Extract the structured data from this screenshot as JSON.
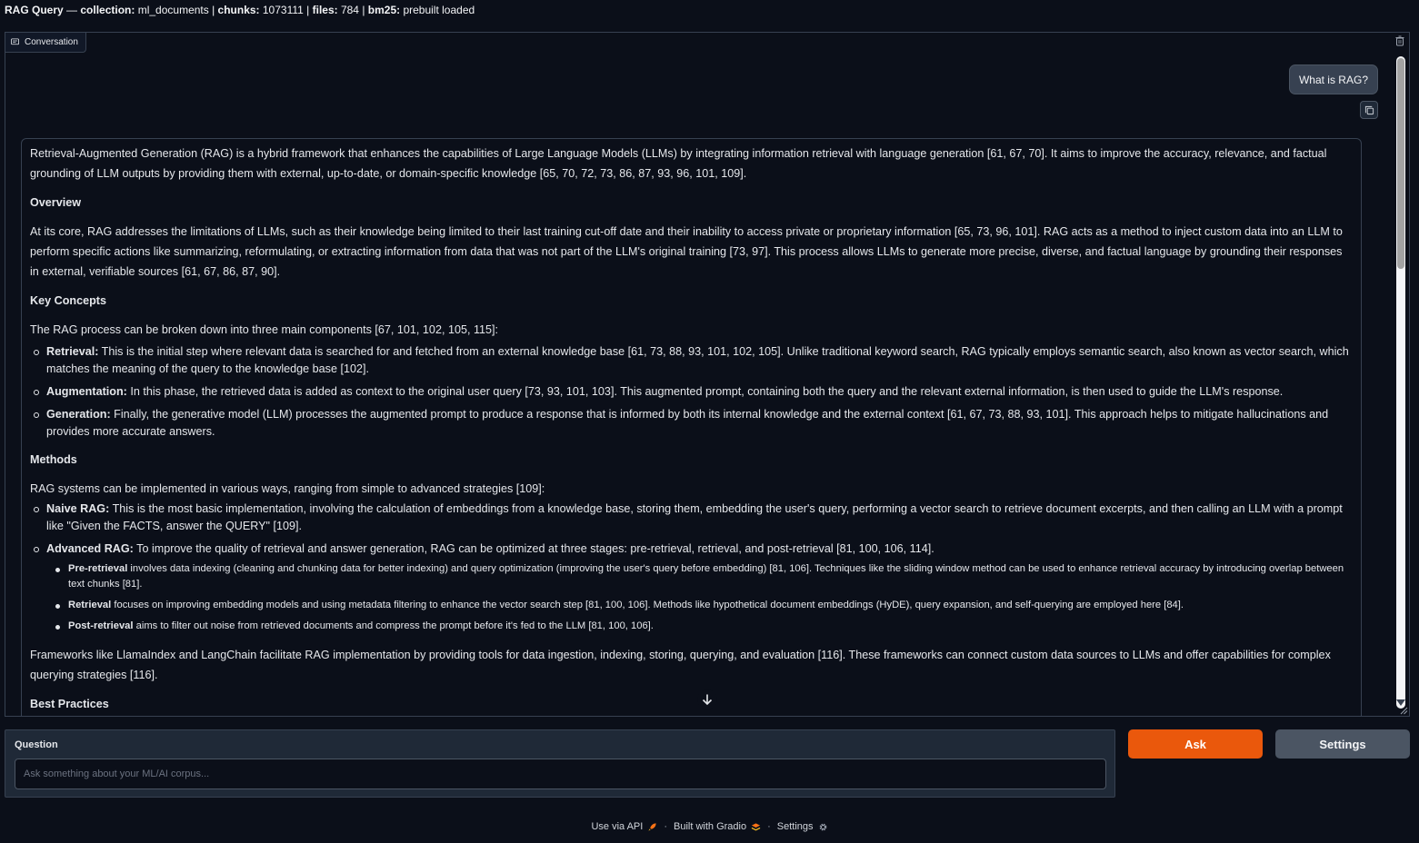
{
  "header": {
    "title": "RAG Query",
    "sep": " — ",
    "collection_label": "collection:",
    "collection_value": " ml_documents | ",
    "chunks_label": "chunks:",
    "chunks_value": " 1073111 | ",
    "files_label": "files:",
    "files_value": " 784 | ",
    "bm25_label": "bm25:",
    "bm25_value": " prebuilt loaded"
  },
  "chat": {
    "label": "Conversation",
    "user_message": "What is RAG?",
    "answer": {
      "intro": "Retrieval-Augmented Generation (RAG) is a hybrid framework that enhances the capabilities of Large Language Models (LLMs) by integrating information retrieval with language generation [61, 67, 70]. It aims to improve the accuracy, relevance, and factual grounding of LLM outputs by providing them with external, up-to-date, or domain-specific knowledge [65, 70, 72, 73, 86, 87, 93, 96, 101, 109].",
      "overview_heading": "Overview",
      "overview_text": "At its core, RAG addresses the limitations of LLMs, such as their knowledge being limited to their last training cut-off date and their inability to access private or proprietary information [65, 73, 96, 101]. RAG acts as a method to inject custom data into an LLM to perform specific actions like summarizing, reformulating, or extracting information from data that was not part of the LLM's original training [73, 97]. This process allows LLMs to generate more precise, diverse, and factual language by grounding their responses in external, verifiable sources [61, 67, 86, 87, 90].",
      "concepts_heading": "Key Concepts",
      "concepts_intro": "The RAG process can be broken down into three main components [67, 101, 102, 105, 115]:",
      "concepts": [
        {
          "term": "Retrieval:",
          "text": " This is the initial step where relevant data is searched for and fetched from an external knowledge base [61, 73, 88, 93, 101, 102, 105]. Unlike traditional keyword search, RAG typically employs semantic search, also known as vector search, which matches the meaning of the query to the knowledge base [102]."
        },
        {
          "term": "Augmentation:",
          "text": " In this phase, the retrieved data is added as context to the original user query [73, 93, 101, 103]. This augmented prompt, containing both the query and the relevant external information, is then used to guide the LLM's response."
        },
        {
          "term": "Generation:",
          "text": " Finally, the generative model (LLM) processes the augmented prompt to produce a response that is informed by both its internal knowledge and the external context [61, 67, 73, 88, 93, 101]. This approach helps to mitigate hallucinations and provides more accurate answers."
        }
      ],
      "methods_heading": "Methods",
      "methods_intro": "RAG systems can be implemented in various ways, ranging from simple to advanced strategies [109]:",
      "methods": [
        {
          "term": "Naive RAG:",
          "text": " This is the most basic implementation, involving the calculation of embeddings from a knowledge base, storing them, embedding the user's query, performing a vector search to retrieve document excerpts, and then calling an LLM with a prompt like \"Given the FACTS, answer the QUERY\" [109]."
        },
        {
          "term": "Advanced RAG:",
          "text": " To improve the quality of retrieval and answer generation, RAG can be optimized at three stages: pre-retrieval, retrieval, and post-retrieval [81, 100, 106, 114]."
        }
      ],
      "advanced": [
        {
          "term": "Pre-retrieval",
          "text": " involves data indexing (cleaning and chunking data for better indexing) and query optimization (improving the user's query before embedding) [81, 106]. Techniques like the sliding window method can be used to enhance retrieval accuracy by introducing overlap between text chunks [81]."
        },
        {
          "term": "Retrieval",
          "text": " focuses on improving embedding models and using metadata filtering to enhance the vector search step [81, 100, 106]. Methods like hypothetical document embeddings (HyDE), query expansion, and self-querying are employed here [84]."
        },
        {
          "term": "Post-retrieval",
          "text": " aims to filter out noise from retrieved documents and compress the prompt before it's fed to the LLM [81, 100, 106]."
        }
      ],
      "frameworks_text": "Frameworks like LlamaIndex and LangChain facilitate RAG implementation by providing tools for data ingestion, indexing, storing, querying, and evaluation [116]. These frameworks can connect custom data sources to LLMs and offer capabilities for complex querying strategies [116].",
      "best_heading": "Best Practices"
    }
  },
  "question": {
    "label": "Question",
    "placeholder": "Ask something about your ML/AI corpus...",
    "value": ""
  },
  "buttons": {
    "ask": "Ask",
    "settings": "Settings"
  },
  "footer": {
    "api": "Use via API",
    "built": "Built with Gradio",
    "settings": "Settings",
    "separator": "·"
  },
  "colors": {
    "background": "#0b0f19",
    "primary": "#ea580c",
    "secondary": "#4b5563"
  }
}
